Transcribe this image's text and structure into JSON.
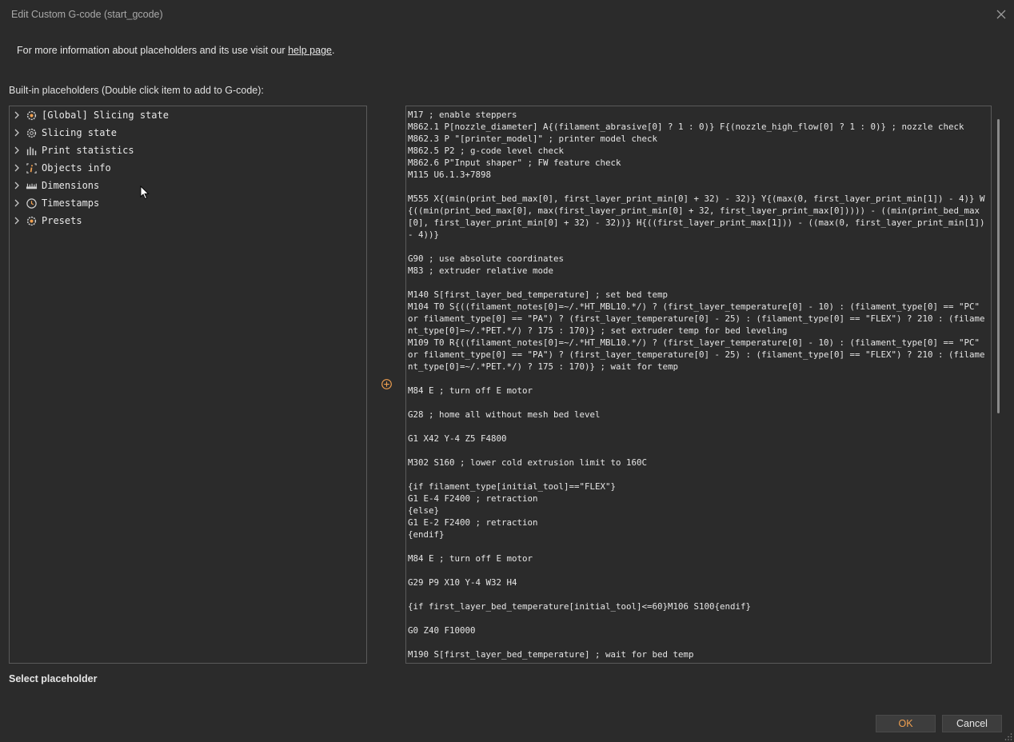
{
  "window": {
    "title": "Edit Custom G-code (start_gcode)"
  },
  "info": {
    "prefix": "For more information about placeholders and its use visit our ",
    "link": "help page",
    "suffix": "."
  },
  "builtin_label": "Built-in placeholders (Double click item to add to G-code):",
  "tree": [
    {
      "label": "[Global] Slicing state",
      "icon": "gear-icon"
    },
    {
      "label": "Slicing state",
      "icon": "gear-icon"
    },
    {
      "label": "Print statistics",
      "icon": "bar-chart-icon"
    },
    {
      "label": "Objects info",
      "icon": "info-icon"
    },
    {
      "label": "Dimensions",
      "icon": "ruler-icon"
    },
    {
      "label": "Timestamps",
      "icon": "clock-icon"
    },
    {
      "label": "Presets",
      "icon": "gear-icon"
    }
  ],
  "gcode": "M17 ; enable steppers\nM862.1 P[nozzle_diameter] A{(filament_abrasive[0] ? 1 : 0)} F{(nozzle_high_flow[0] ? 1 : 0)} ; nozzle check\nM862.3 P \"[printer_model]\" ; printer model check\nM862.5 P2 ; g-code level check\nM862.6 P\"Input shaper\" ; FW feature check\nM115 U6.1.3+7898\n\nM555 X{(min(print_bed_max[0], first_layer_print_min[0] + 32) - 32)} Y{(max(0, first_layer_print_min[1]) - 4)} W{((min(print_bed_max[0], max(first_layer_print_min[0] + 32, first_layer_print_max[0])))) - ((min(print_bed_max[0], first_layer_print_min[0] + 32) - 32))} H{((first_layer_print_max[1])) - ((max(0, first_layer_print_min[1]) - 4))}\n\nG90 ; use absolute coordinates\nM83 ; extruder relative mode\n\nM140 S[first_layer_bed_temperature] ; set bed temp\nM104 T0 S{((filament_notes[0]=~/.*HT_MBL10.*/) ? (first_layer_temperature[0] - 10) : (filament_type[0] == \"PC\" or filament_type[0] == \"PA\") ? (first_layer_temperature[0] - 25) : (filament_type[0] == \"FLEX\") ? 210 : (filament_type[0]=~/.*PET.*/) ? 175 : 170)} ; set extruder temp for bed leveling\nM109 T0 R{((filament_notes[0]=~/.*HT_MBL10.*/) ? (first_layer_temperature[0] - 10) : (filament_type[0] == \"PC\" or filament_type[0] == \"PA\") ? (first_layer_temperature[0] - 25) : (filament_type[0] == \"FLEX\") ? 210 : (filament_type[0]=~/.*PET.*/) ? 175 : 170)} ; wait for temp\n\nM84 E ; turn off E motor\n\nG28 ; home all without mesh bed level\n\nG1 X42 Y-4 Z5 F4800\n\nM302 S160 ; lower cold extrusion limit to 160C\n\n{if filament_type[initial_tool]==\"FLEX\"}\nG1 E-4 F2400 ; retraction\n{else}\nG1 E-2 F2400 ; retraction\n{endif}\n\nM84 E ; turn off E motor\n\nG29 P9 X10 Y-4 W32 H4\n\n{if first_layer_bed_temperature[initial_tool]<=60}M106 S100{endif}\n\nG0 Z40 F10000\n\nM190 S[first_layer_bed_temperature] ; wait for bed temp",
  "select_label": "Select placeholder",
  "buttons": {
    "ok": "OK",
    "cancel": "Cancel"
  },
  "colors": {
    "background": "#2b2b2b",
    "accent": "#f0a050",
    "border": "#5a5a5a"
  }
}
